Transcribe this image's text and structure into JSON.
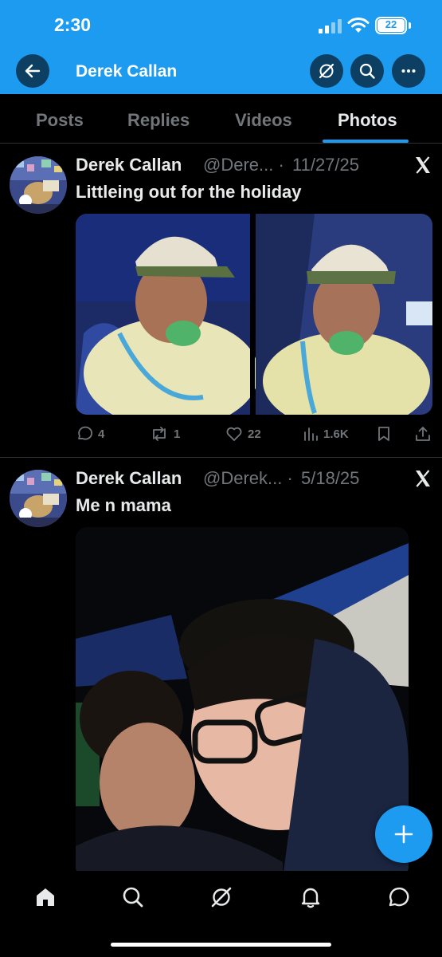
{
  "status": {
    "time": "2:30",
    "battery": "22"
  },
  "header": {
    "title": "Derek Callan"
  },
  "tabs": [
    {
      "label": "Posts"
    },
    {
      "label": "Replies"
    },
    {
      "label": "Videos"
    },
    {
      "label": "Photos",
      "active": true
    }
  ],
  "posts": [
    {
      "name": "Derek Callan",
      "handle": "@Dere... ·",
      "date": "11/27/25",
      "text": "Littleing out for the holiday",
      "stats": {
        "replies": "4",
        "reposts": "1",
        "likes": "22",
        "views": "1.6K"
      }
    },
    {
      "name": "Derek Callan",
      "handle": "@Derek... ·",
      "date": "5/18/25",
      "text": "Me n mama"
    }
  ],
  "icons": {
    "back": "arrow-left-icon",
    "grok": "grok-icon",
    "search": "search-icon",
    "more": "more-icon",
    "x": "x-logo-icon",
    "fab": "plus-icon"
  },
  "colors": {
    "accent": "#1d9bf0",
    "muted": "#71767b",
    "text": "#e7e9ea",
    "background": "#000000"
  }
}
